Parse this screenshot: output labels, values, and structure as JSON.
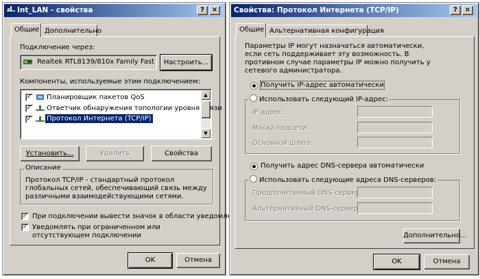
{
  "left": {
    "title": "Int_LAN - свойства",
    "tabs": [
      "Общие",
      "Дополнительно"
    ],
    "connect_via_label": "Подключение через:",
    "adapter": "Realtek RTL8139/810x Family Fast",
    "configure": "Настроить...",
    "components_label": "Компоненты, используемые этим подключением:",
    "components": [
      {
        "label": "Планировщик пакетов QoS",
        "checked": true,
        "selected": false
      },
      {
        "label": "Ответчик обнаружения топологии уровня связи",
        "checked": true,
        "selected": false
      },
      {
        "label": "Протокол Интернета (TCP/IP)",
        "checked": true,
        "selected": true
      }
    ],
    "install": "Установить...",
    "remove": "Удалить",
    "properties": "Свойства",
    "description_title": "Описание",
    "description": "Протокол TCP/IP - стандартный протокол глобальных сетей, обеспечивающий связь между различными взаимодействующими сетями.",
    "show_icon": "При подключении вывести значок в области уведомлений",
    "notify": "Уведомлять при ограниченном или отсутствующем подключении",
    "ok": "OK",
    "cancel": "Отмена"
  },
  "right": {
    "title": "Свойства: Протокол Интернета (TCP/IP)",
    "tabs": [
      "Общие",
      "Альтернативная конфигурация"
    ],
    "intro": "Параметры IP могут назначаться автоматически, если сеть поддерживает эту возможность. В противном случае параметры IP можно получить у сетевого администратора.",
    "auto_ip": "Получить IP-адрес автоматически",
    "manual_ip": "Использовать следующий IP-адрес:",
    "ip_label": "IP-адрес:",
    "mask_label": "Маска подсети:",
    "gateway_label": "Основной шлюз:",
    "auto_dns": "Получить адрес DNS-сервера автоматически",
    "manual_dns": "Использовать следующие адреса DNS-серверов:",
    "pref_dns": "Предпочитаемый DNS-сервер:",
    "alt_dns": "Альтернативный DNS-сервер:",
    "advanced": "Дополнительно...",
    "ok": "OK",
    "cancel": "Отмена"
  },
  "title_buttons": {
    "help": "?",
    "close": "×"
  }
}
